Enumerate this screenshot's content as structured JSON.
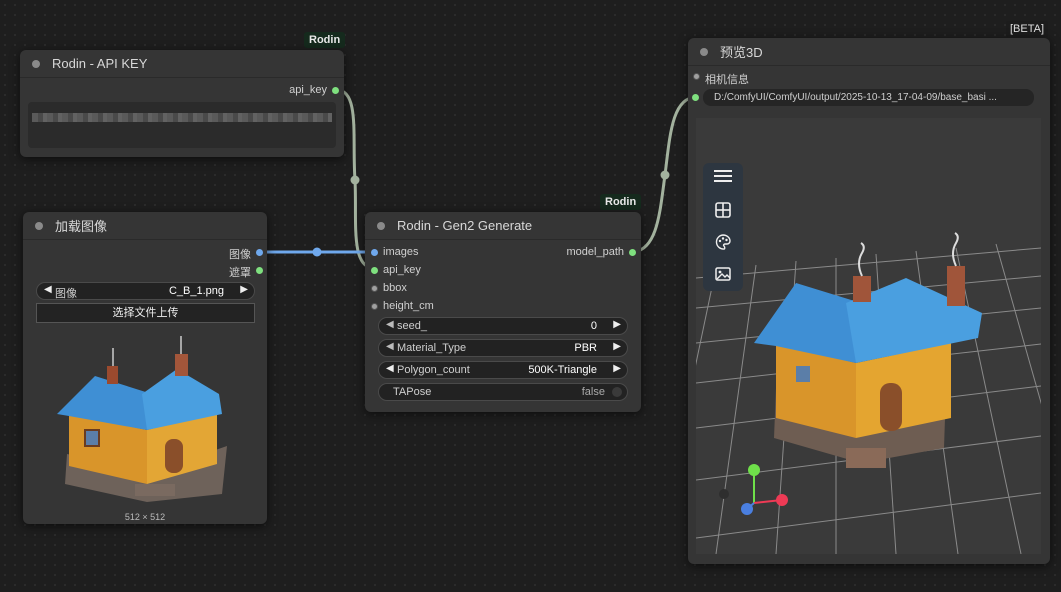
{
  "canvas": {
    "background": "#1e1e1e"
  },
  "links": {
    "green": "#a3b29e",
    "blue": "#6fa8ec"
  },
  "api_key_node": {
    "title": "Rodin - API KEY",
    "badge": "Rodin",
    "output": "api_key"
  },
  "load_image_node": {
    "title": "加载图像",
    "outputs": [
      "图像",
      "遮罩"
    ],
    "image_widget": {
      "label": "图像",
      "value": "C_B_1.png"
    },
    "upload_button": "选择文件上传",
    "image_caption": "512 × 512"
  },
  "gen2_node": {
    "title": "Rodin - Gen2 Generate",
    "badge": "Rodin",
    "inputs": [
      "images",
      "api_key",
      "bbox",
      "height_cm"
    ],
    "output": "model_path",
    "widgets": [
      {
        "label": "seed_",
        "value": "0"
      },
      {
        "label": "Material_Type",
        "value": "PBR"
      },
      {
        "label": "Polygon_count",
        "value": "500K-Triangle"
      }
    ],
    "toggle": {
      "label": "TAPose",
      "value": "false"
    }
  },
  "preview_node": {
    "title": "预览3D",
    "badge": "[BETA]",
    "inputs": [
      "相机信息"
    ],
    "model_path_value": "D:/ComfyUI/ComfyUI/output/2025-10-13_17-04-09/base_basi ...",
    "toolbar_icons": [
      "menu-icon",
      "grid-view-icon",
      "palette-icon",
      "image-icon"
    ]
  }
}
